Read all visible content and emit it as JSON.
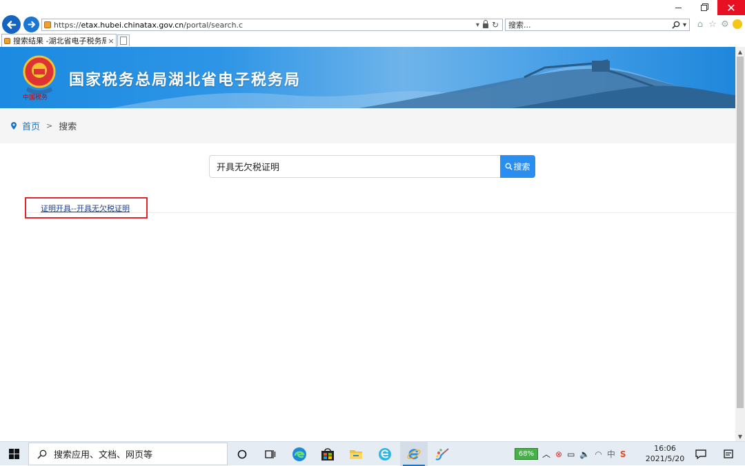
{
  "browser": {
    "url_prefix": "https://",
    "url_domain": "etax.hubei.chinatax.gov.cn",
    "url_path": "/portal/search.c",
    "search_placeholder": "搜索...",
    "tab_title": "搜索结果 -湖北省电子税务局",
    "tab_close": "×",
    "close_glyph": "✕"
  },
  "site": {
    "title": "国家税务总局湖北省电子税务局",
    "emblem_text": "中国税务"
  },
  "breadcrumb": {
    "home": "首页",
    "separator": ">",
    "current": "搜索"
  },
  "search": {
    "query": "开具无欠税证明",
    "button_label": "搜索"
  },
  "results": [
    {
      "title": "证明开具--开具无欠税证明"
    }
  ],
  "taskbar": {
    "search_placeholder": "搜索应用、文档、网页等",
    "battery": "68%",
    "ime": "中",
    "time": "16:06",
    "date": "2021/5/20"
  },
  "colors": {
    "accent": "#2a8ef0",
    "banner": "#2e95e6",
    "highlight_box": "#e0252b",
    "link": "#1a73c7"
  }
}
